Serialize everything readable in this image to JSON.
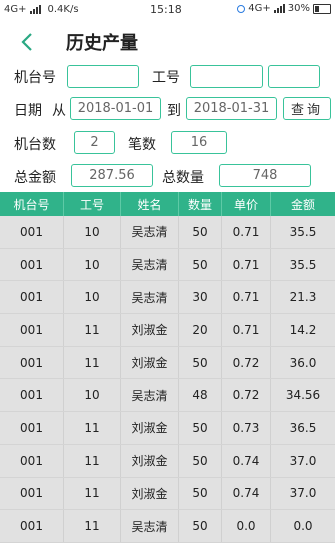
{
  "status_bar": {
    "network": "4G+",
    "speed": "0.4K/s",
    "time": "15:18",
    "network_right": "4G+",
    "battery": "30%"
  },
  "header": {
    "title": "历史产量"
  },
  "filters": {
    "machine_label": "机台号",
    "machine_value": "",
    "worker_label": "工号",
    "worker_value_1": "",
    "worker_value_2": "",
    "date_label": "日期",
    "from_label": "从",
    "date_from": "2018-01-01",
    "to_label": "到",
    "date_to": "2018-01-31",
    "query_label": "查询"
  },
  "summary": {
    "machine_count_label": "机台数",
    "machine_count": "2",
    "record_count_label": "笔数",
    "record_count": "16",
    "total_amount_label": "总金额",
    "total_amount": "287.56",
    "total_qty_label": "总数量",
    "total_qty": "748"
  },
  "table": {
    "columns": [
      "机台号",
      "工号",
      "姓名",
      "数量",
      "单价",
      "金额"
    ],
    "rows": [
      [
        "001",
        "10",
        "吴志清",
        "50",
        "0.71",
        "35.5"
      ],
      [
        "001",
        "10",
        "吴志清",
        "50",
        "0.71",
        "35.5"
      ],
      [
        "001",
        "10",
        "吴志清",
        "30",
        "0.71",
        "21.3"
      ],
      [
        "001",
        "11",
        "刘淑金",
        "20",
        "0.71",
        "14.2"
      ],
      [
        "001",
        "11",
        "刘淑金",
        "50",
        "0.72",
        "36.0"
      ],
      [
        "001",
        "10",
        "吴志清",
        "48",
        "0.72",
        "34.56"
      ],
      [
        "001",
        "11",
        "刘淑金",
        "50",
        "0.73",
        "36.5"
      ],
      [
        "001",
        "11",
        "刘淑金",
        "50",
        "0.74",
        "37.0"
      ],
      [
        "001",
        "11",
        "刘淑金",
        "50",
        "0.74",
        "37.0"
      ],
      [
        "001",
        "11",
        "吴志清",
        "50",
        "0.0",
        "0.0"
      ]
    ]
  }
}
